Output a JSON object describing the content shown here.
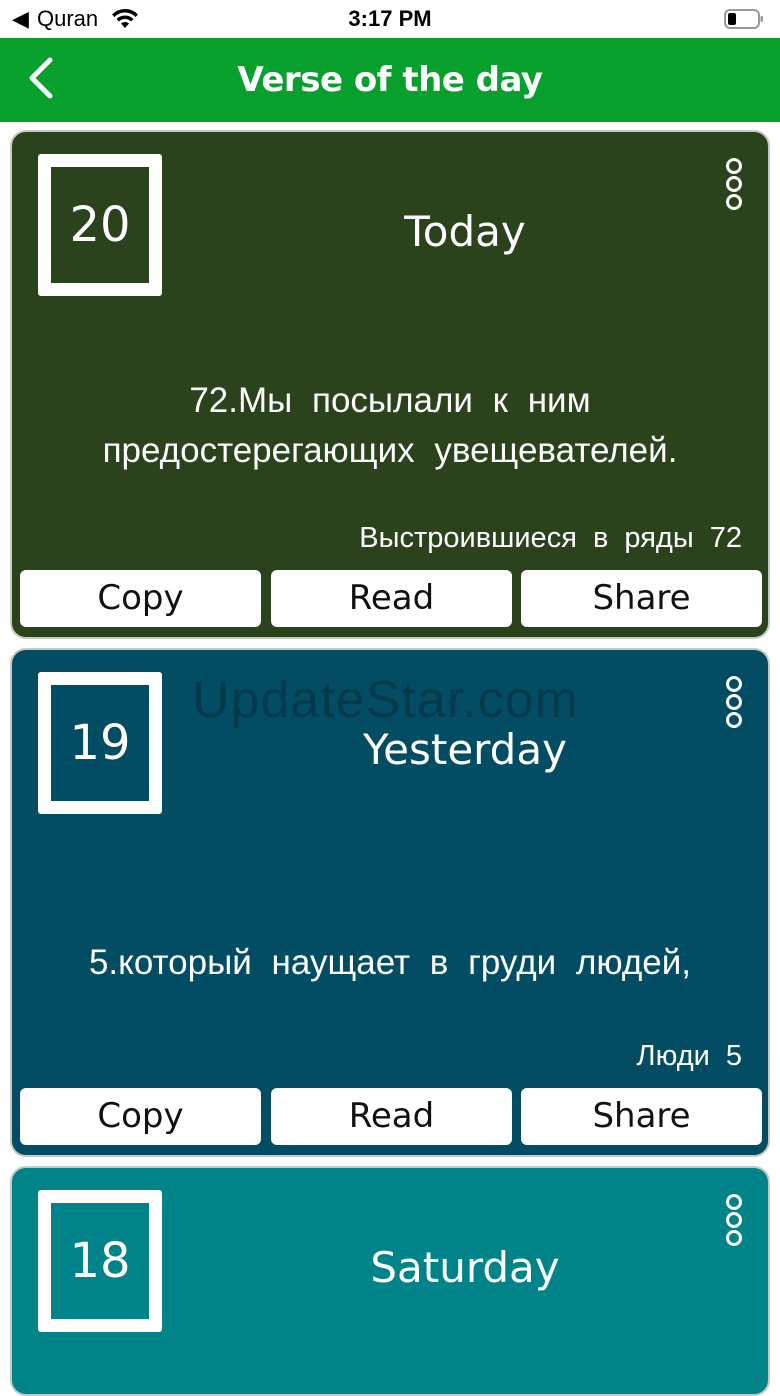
{
  "status_bar": {
    "back_glyph": "◀",
    "app_name": "Quran",
    "time": "3:17 PM",
    "wifi_icon": "wifi-icon",
    "battery_icon": "battery-icon"
  },
  "nav": {
    "title": "Verse of the day",
    "back_icon": "chevron-left-icon"
  },
  "cards": [
    {
      "date_number": "20",
      "day_label": "Today",
      "verse_lines": [
        "72.Мы посылали к ним",
        "предостерегающих увещевателей."
      ],
      "source": "Выстроившиеся в ряды 72",
      "buttons": {
        "copy": "Copy",
        "read": "Read",
        "share": "Share"
      },
      "color": "#2b431d"
    },
    {
      "date_number": "19",
      "day_label": "Yesterday",
      "verse_lines": [
        "5.который наущает в груди людей,"
      ],
      "source": "Люди 5",
      "buttons": {
        "copy": "Copy",
        "read": "Read",
        "share": "Share"
      },
      "color": "#024d63"
    },
    {
      "date_number": "18",
      "day_label": "Saturday",
      "color": "#00848a"
    }
  ],
  "watermark": "UpdateStar.com",
  "colors": {
    "nav_bar": "#07a02d",
    "white": "#ffffff"
  }
}
